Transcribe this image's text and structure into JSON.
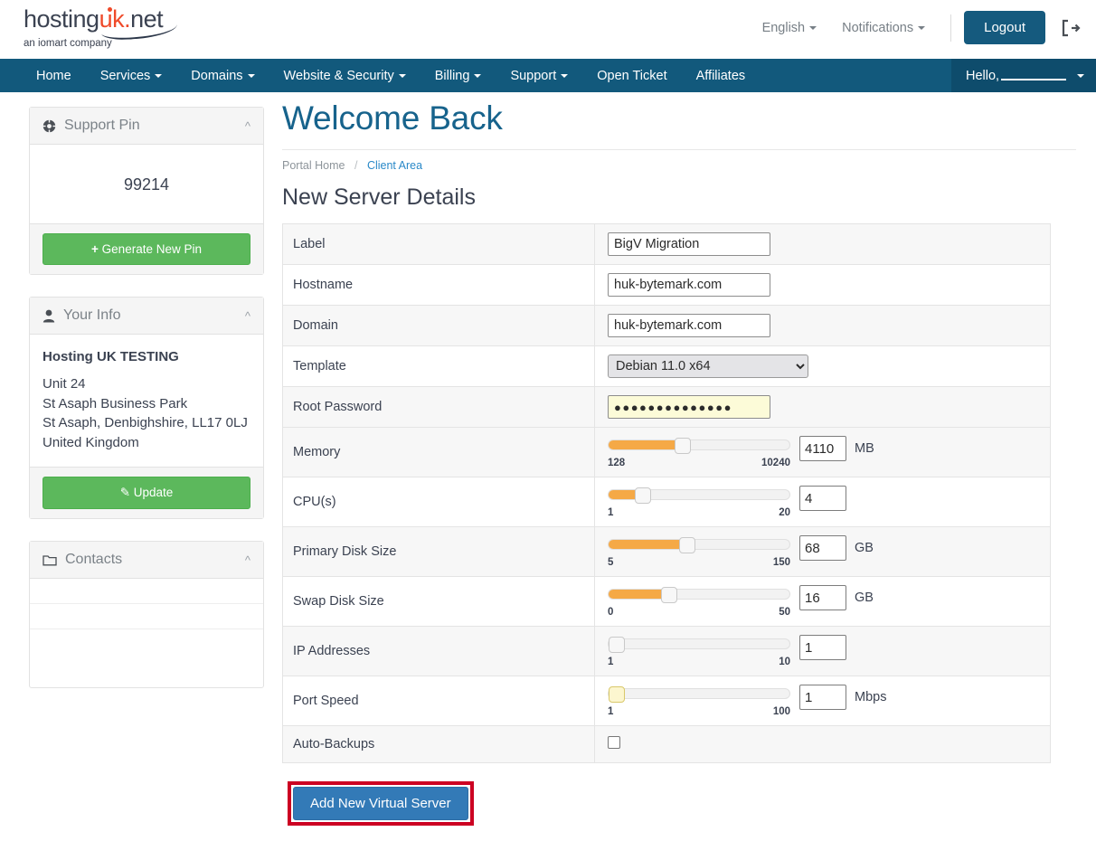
{
  "brand": {
    "logo_part1": "hosting",
    "logo_part2": "uk",
    "logo_dot": ".",
    "logo_part3": "net",
    "tagline": "an iomart company",
    "accent_red": "#ef4a2a",
    "nav_blue": "#12597c",
    "link_blue": "#2a89c8",
    "heading_blue": "#17638c",
    "slider_orange": "#f5a946",
    "green": "#5cb85c",
    "highlight_red": "#cc0022"
  },
  "topbar": {
    "language": "English",
    "notifications": "Notifications",
    "logout": "Logout"
  },
  "nav": {
    "items": [
      {
        "label": "Home",
        "caret": false
      },
      {
        "label": "Services",
        "caret": true
      },
      {
        "label": "Domains",
        "caret": true
      },
      {
        "label": "Website & Security",
        "caret": true
      },
      {
        "label": "Billing",
        "caret": true
      },
      {
        "label": "Support",
        "caret": true
      },
      {
        "label": "Open Ticket",
        "caret": false
      },
      {
        "label": "Affiliates",
        "caret": false
      }
    ],
    "user_greeting": "Hello,"
  },
  "sidebar": {
    "support_pin": {
      "title": "Support Pin",
      "icon": "lifebuoy-icon",
      "pin": "99214",
      "button": "Generate New Pin",
      "button_icon": "plus-icon"
    },
    "your_info": {
      "title": "Your Info",
      "icon": "user-icon",
      "company": "Hosting UK TESTING",
      "address_lines": [
        "Unit 24",
        "St Asaph Business Park",
        "St Asaph, Denbighshire, LL17 0LJ",
        "United Kingdom"
      ],
      "button": "Update",
      "button_icon": "pencil-icon"
    },
    "contacts": {
      "title": "Contacts",
      "icon": "folder-icon"
    }
  },
  "main": {
    "welcome_title": "Welcome Back",
    "breadcrumb": {
      "home": "Portal Home",
      "separator": "/",
      "current": "Client Area"
    },
    "section_title": "New Server Details",
    "submit_button": "Add New Virtual Server",
    "rows": [
      {
        "kind": "text",
        "label": "Label",
        "value": "BigV Migration",
        "stripe": "gray"
      },
      {
        "kind": "text",
        "label": "Hostname",
        "value": "huk-bytemark.com",
        "stripe": "white"
      },
      {
        "kind": "text",
        "label": "Domain",
        "value": "huk-bytemark.com",
        "stripe": "gray"
      },
      {
        "kind": "select",
        "label": "Template",
        "value": "Debian 11.0 x64",
        "stripe": "white"
      },
      {
        "kind": "password",
        "label": "Root Password",
        "value": "●●●●●●●●●●●●●●",
        "stripe": "gray"
      },
      {
        "kind": "slider",
        "label": "Memory",
        "min": "128",
        "max": "10240",
        "value": "4110",
        "unit": "MB",
        "percent": 40,
        "focused": false,
        "stripe": "gray"
      },
      {
        "kind": "slider",
        "label": "CPU(s)",
        "min": "1",
        "max": "20",
        "value": "4",
        "unit": "",
        "percent": 16,
        "focused": false,
        "stripe": "white"
      },
      {
        "kind": "slider",
        "label": "Primary Disk Size",
        "min": "5",
        "max": "150",
        "value": "68",
        "unit": "GB",
        "percent": 43,
        "focused": false,
        "stripe": "gray"
      },
      {
        "kind": "slider",
        "label": "Swap Disk Size",
        "min": "0",
        "max": "50",
        "value": "16",
        "unit": "GB",
        "percent": 32,
        "focused": false,
        "stripe": "white"
      },
      {
        "kind": "slider",
        "label": "IP Addresses",
        "min": "1",
        "max": "10",
        "value": "1",
        "unit": "",
        "percent": 0,
        "focused": false,
        "stripe": "gray"
      },
      {
        "kind": "slider",
        "label": "Port Speed",
        "min": "1",
        "max": "100",
        "value": "1",
        "unit": "Mbps",
        "percent": 0,
        "focused": true,
        "stripe": "white"
      },
      {
        "kind": "checkbox",
        "label": "Auto-Backups",
        "checked": false,
        "stripe": "gray"
      }
    ]
  }
}
